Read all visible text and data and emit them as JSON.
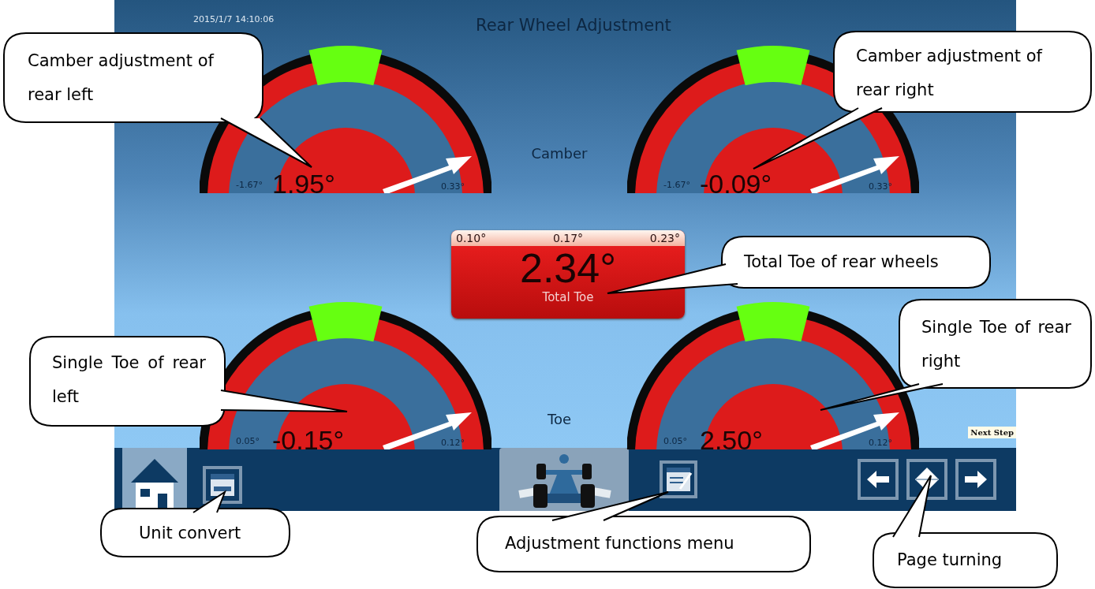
{
  "screen": {
    "timestamp": "2015/1/7 14:10:06",
    "title": "Rear Wheel Adjustment",
    "camber_label": "Camber",
    "toe_label": "Toe",
    "camber_gauges": [
      {
        "reading": "1.95°",
        "min": "-1.67°",
        "max": "0.33°"
      },
      {
        "reading": "-0.09°",
        "min": "-1.67°",
        "max": "0.33°"
      }
    ],
    "toe_gauges": [
      {
        "reading": "-0.15°",
        "min": "0.05°",
        "max": "0.12°"
      },
      {
        "reading": "2.50°",
        "min": "0.05°",
        "max": "0.12°"
      }
    ],
    "total_toe": {
      "min": "0.10°",
      "target": "0.17°",
      "max": "0.23°",
      "reading": "2.34°",
      "label": "Total Toe"
    },
    "next_step_tooltip": "Next Step"
  },
  "callouts": [
    {
      "text": "Camber adjustment of rear left"
    },
    {
      "text": "Camber adjustment of rear right"
    },
    {
      "text": "Total Toe of rear wheels"
    },
    {
      "text": "Single Toe of rear left"
    },
    {
      "text": "Single Toe of rear right"
    },
    {
      "text": "Unit convert"
    },
    {
      "text": "Adjustment functions menu"
    },
    {
      "text": "Page turning"
    }
  ]
}
